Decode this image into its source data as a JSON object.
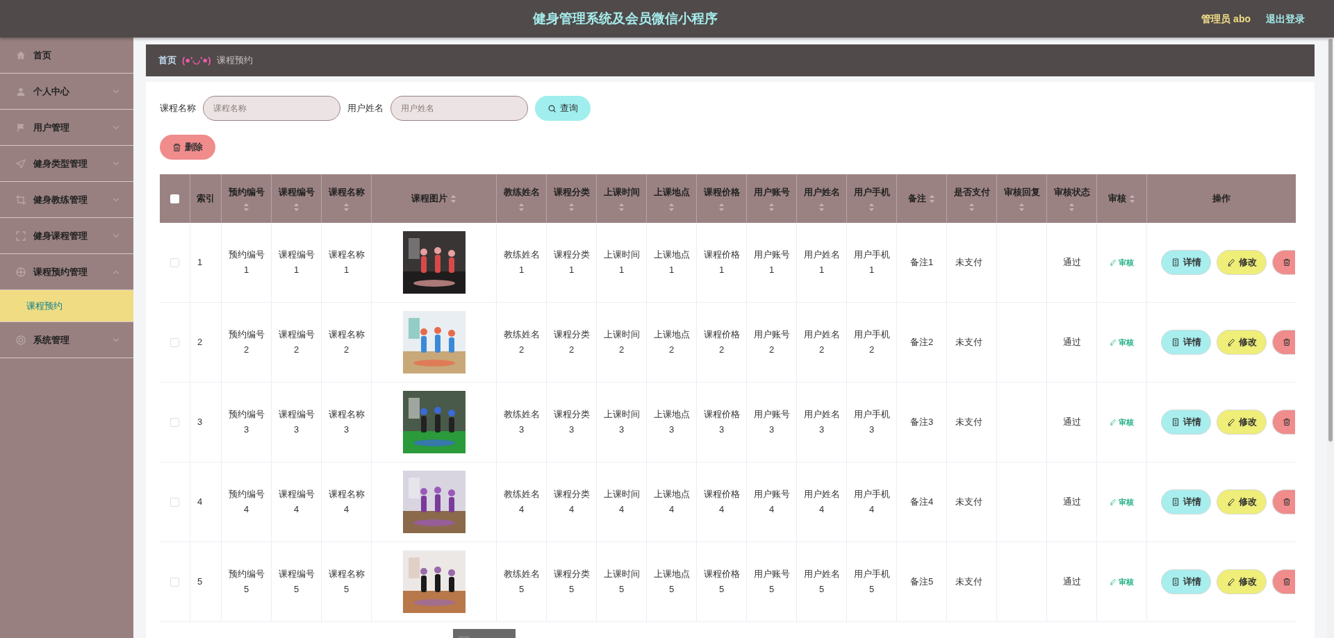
{
  "header": {
    "title": "健身管理系统及会员微信小程序",
    "user": "管理员 abo",
    "logout": "退出登录"
  },
  "sidebar": {
    "items": [
      {
        "label": "首页",
        "expandable": false,
        "selected": false
      },
      {
        "label": "个人中心",
        "expandable": true,
        "expanded": false,
        "selected": false
      },
      {
        "label": "用户管理",
        "expandable": true,
        "expanded": false,
        "selected": false
      },
      {
        "label": "健身类型管理",
        "expandable": true,
        "expanded": false,
        "selected": false
      },
      {
        "label": "健身教练管理",
        "expandable": true,
        "expanded": false,
        "selected": false
      },
      {
        "label": "健身课程管理",
        "expandable": true,
        "expanded": false,
        "selected": false
      },
      {
        "label": "课程预约管理",
        "expandable": true,
        "expanded": true,
        "selected": false,
        "children": [
          {
            "label": "课程预约",
            "selected": true
          }
        ]
      },
      {
        "label": "系统管理",
        "expandable": true,
        "expanded": false,
        "selected": false
      }
    ]
  },
  "breadcrumb": {
    "home": "首页",
    "separator": "(●'◡'●)",
    "current": "课程预约"
  },
  "search": {
    "fields": [
      {
        "label": "课程名称",
        "placeholder": "课程名称"
      },
      {
        "label": "用户姓名",
        "placeholder": "用户姓名"
      }
    ],
    "button": "查询"
  },
  "toolbar": {
    "delete": "删除"
  },
  "table": {
    "select_all_checked": false,
    "columns": [
      {
        "label": "索引",
        "kind": "plain"
      },
      {
        "label": "预约编号",
        "kind": "stacked"
      },
      {
        "label": "课程编号",
        "kind": "stacked"
      },
      {
        "label": "课程名称",
        "kind": "stacked"
      },
      {
        "label": "课程图片",
        "kind": "inline"
      },
      {
        "label": "教练姓名",
        "kind": "stacked"
      },
      {
        "label": "课程分类",
        "kind": "stacked"
      },
      {
        "label": "上课时间",
        "kind": "stacked"
      },
      {
        "label": "上课地点",
        "kind": "stacked"
      },
      {
        "label": "课程价格",
        "kind": "stacked"
      },
      {
        "label": "用户账号",
        "kind": "stacked"
      },
      {
        "label": "用户姓名",
        "kind": "stacked"
      },
      {
        "label": "用户手机",
        "kind": "stacked"
      },
      {
        "label": "备注",
        "kind": "inline"
      },
      {
        "label": "是否支付",
        "kind": "stacked"
      },
      {
        "label": "审核回复",
        "kind": "stacked"
      },
      {
        "label": "审核状态",
        "kind": "stacked"
      },
      {
        "label": "审核",
        "kind": "inline"
      },
      {
        "label": "操作",
        "kind": "plain"
      }
    ],
    "rows": [
      {
        "checked": false,
        "cells": [
          {
            "kind": "index",
            "text": "1"
          },
          {
            "kind": "wrap",
            "text": "预约编号1"
          },
          {
            "kind": "wrap",
            "text": "课程编号1"
          },
          {
            "kind": "wrap",
            "text": "课程名称1"
          },
          {
            "kind": "picture"
          },
          {
            "kind": "wrap",
            "text": "教练姓名1"
          },
          {
            "kind": "wrap",
            "text": "课程分类1"
          },
          {
            "kind": "wrap",
            "text": "上课时间1"
          },
          {
            "kind": "wrap",
            "text": "上课地点1"
          },
          {
            "kind": "wrap",
            "text": "课程价格1"
          },
          {
            "kind": "wrap",
            "text": "用户账号1"
          },
          {
            "kind": "wrap",
            "text": "用户姓名1"
          },
          {
            "kind": "wrap",
            "text": "用户手机1"
          },
          {
            "kind": "center",
            "text": "备注1"
          },
          {
            "kind": "left",
            "text": "未支付"
          },
          {
            "kind": "empty"
          },
          {
            "kind": "center",
            "text": "通过"
          },
          {
            "kind": "link",
            "text": "审核"
          },
          {
            "kind": "actions",
            "buttons": [
              "详情",
              "修改"
            ]
          }
        ]
      },
      {
        "checked": false,
        "cells": [
          {
            "kind": "index",
            "text": "2"
          },
          {
            "kind": "wrap",
            "text": "预约编号2"
          },
          {
            "kind": "wrap",
            "text": "课程编号2"
          },
          {
            "kind": "wrap",
            "text": "课程名称2"
          },
          {
            "kind": "picture"
          },
          {
            "kind": "wrap",
            "text": "教练姓名2"
          },
          {
            "kind": "wrap",
            "text": "课程分类2"
          },
          {
            "kind": "wrap",
            "text": "上课时间2"
          },
          {
            "kind": "wrap",
            "text": "上课地点2"
          },
          {
            "kind": "wrap",
            "text": "课程价格2"
          },
          {
            "kind": "wrap",
            "text": "用户账号2"
          },
          {
            "kind": "wrap",
            "text": "用户姓名2"
          },
          {
            "kind": "wrap",
            "text": "用户手机2"
          },
          {
            "kind": "center",
            "text": "备注2"
          },
          {
            "kind": "left",
            "text": "未支付"
          },
          {
            "kind": "empty"
          },
          {
            "kind": "center",
            "text": "通过"
          },
          {
            "kind": "link",
            "text": "审核"
          },
          {
            "kind": "actions",
            "buttons": [
              "详情",
              "修改"
            ]
          }
        ]
      },
      {
        "checked": false,
        "cells": [
          {
            "kind": "index",
            "text": "3"
          },
          {
            "kind": "wrap",
            "text": "预约编号3"
          },
          {
            "kind": "wrap",
            "text": "课程编号3"
          },
          {
            "kind": "wrap",
            "text": "课程名称3"
          },
          {
            "kind": "picture"
          },
          {
            "kind": "wrap",
            "text": "教练姓名3"
          },
          {
            "kind": "wrap",
            "text": "课程分类3"
          },
          {
            "kind": "wrap",
            "text": "上课时间3"
          },
          {
            "kind": "wrap",
            "text": "上课地点3"
          },
          {
            "kind": "wrap",
            "text": "课程价格3"
          },
          {
            "kind": "wrap",
            "text": "用户账号3"
          },
          {
            "kind": "wrap",
            "text": "用户姓名3"
          },
          {
            "kind": "wrap",
            "text": "用户手机3"
          },
          {
            "kind": "center",
            "text": "备注3"
          },
          {
            "kind": "left",
            "text": "未支付"
          },
          {
            "kind": "empty"
          },
          {
            "kind": "center",
            "text": "通过"
          },
          {
            "kind": "link",
            "text": "审核"
          },
          {
            "kind": "actions",
            "buttons": [
              "详情",
              "修改"
            ]
          }
        ]
      },
      {
        "checked": false,
        "cells": [
          {
            "kind": "index",
            "text": "4"
          },
          {
            "kind": "wrap",
            "text": "预约编号4"
          },
          {
            "kind": "wrap",
            "text": "课程编号4"
          },
          {
            "kind": "wrap",
            "text": "课程名称4"
          },
          {
            "kind": "picture"
          },
          {
            "kind": "wrap",
            "text": "教练姓名4"
          },
          {
            "kind": "wrap",
            "text": "课程分类4"
          },
          {
            "kind": "wrap",
            "text": "上课时间4"
          },
          {
            "kind": "wrap",
            "text": "上课地点4"
          },
          {
            "kind": "wrap",
            "text": "课程价格4"
          },
          {
            "kind": "wrap",
            "text": "用户账号4"
          },
          {
            "kind": "wrap",
            "text": "用户姓名4"
          },
          {
            "kind": "wrap",
            "text": "用户手机4"
          },
          {
            "kind": "center",
            "text": "备注4"
          },
          {
            "kind": "left",
            "text": "未支付"
          },
          {
            "kind": "empty"
          },
          {
            "kind": "center",
            "text": "通过"
          },
          {
            "kind": "link",
            "text": "审核"
          },
          {
            "kind": "actions",
            "buttons": [
              "详情",
              "修改"
            ]
          }
        ]
      },
      {
        "checked": false,
        "cells": [
          {
            "kind": "index",
            "text": "5"
          },
          {
            "kind": "wrap",
            "text": "预约编号5"
          },
          {
            "kind": "wrap",
            "text": "课程编号5"
          },
          {
            "kind": "wrap",
            "text": "课程名称5"
          },
          {
            "kind": "picture"
          },
          {
            "kind": "wrap",
            "text": "教练姓名5"
          },
          {
            "kind": "wrap",
            "text": "课程分类5"
          },
          {
            "kind": "wrap",
            "text": "上课时间5"
          },
          {
            "kind": "wrap",
            "text": "上课地点5"
          },
          {
            "kind": "wrap",
            "text": "课程价格5"
          },
          {
            "kind": "wrap",
            "text": "用户账号5"
          },
          {
            "kind": "wrap",
            "text": "用户姓名5"
          },
          {
            "kind": "wrap",
            "text": "用户手机5"
          },
          {
            "kind": "center",
            "text": "备注5"
          },
          {
            "kind": "left",
            "text": "未支付"
          },
          {
            "kind": "empty"
          },
          {
            "kind": "center",
            "text": "通过"
          },
          {
            "kind": "link",
            "text": "审核"
          },
          {
            "kind": "actions",
            "buttons": [
              "详情",
              "修改"
            ]
          }
        ]
      }
    ],
    "partial_rows": [
      {
        "picture": {
          "kind": "picture"
        }
      }
    ]
  }
}
